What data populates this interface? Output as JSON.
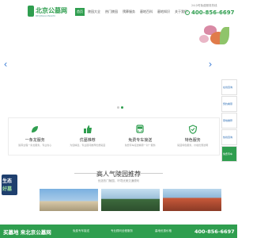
{
  "header": {
    "logo_text": "北京公墓网",
    "logo_sub": "BEIJINGGONGMU",
    "nav": [
      "首页",
      "陵园大全",
      "热门陵园",
      "殡葬服务",
      "墓地百科",
      "墓地知识",
      "关于我们"
    ],
    "hotline_label": "24小时免费服务热线",
    "hotline_number": "400-856-6697"
  },
  "banner": {
    "prev_glyph": "‹",
    "next_glyph": "›",
    "active_slide": 2,
    "slide_count": 3
  },
  "sidebar": {
    "items": [
      "在线咨询",
      "预约看墓",
      "墓地推荐",
      "热线咨询",
      "免费专车"
    ]
  },
  "services": [
    {
      "icon": "leaf-icon",
      "title": "一条龙服务",
      "desc": "殡葬全程一条龙服务，专业省心"
    },
    {
      "icon": "thumbs-up-icon",
      "title": "优墓推荐",
      "desc": "为您精选，专业顾问推荐优质陵园"
    },
    {
      "icon": "bus-icon",
      "title": "免费专车接送",
      "desc": "免费专车接送看墓一对一服务"
    },
    {
      "icon": "shield-icon",
      "title": "特色服务",
      "desc": "陵园特色服务，价格优惠透明"
    }
  ],
  "section": {
    "title": "高人气陵园推荐",
    "subtitle": "优选热门陵园，环境优美交通便利"
  },
  "ad": {
    "line1": "生态",
    "line2": "好墓"
  },
  "bottom": {
    "brand": "买墓地 来北京公墓网",
    "links": [
      "免费专车接送",
      "专业顾问全程服务",
      "墓地优惠价格"
    ],
    "phone": "400-856-6697"
  },
  "colors": {
    "brand_green": "#2f9e4f",
    "link_blue": "#2f6fb5"
  }
}
